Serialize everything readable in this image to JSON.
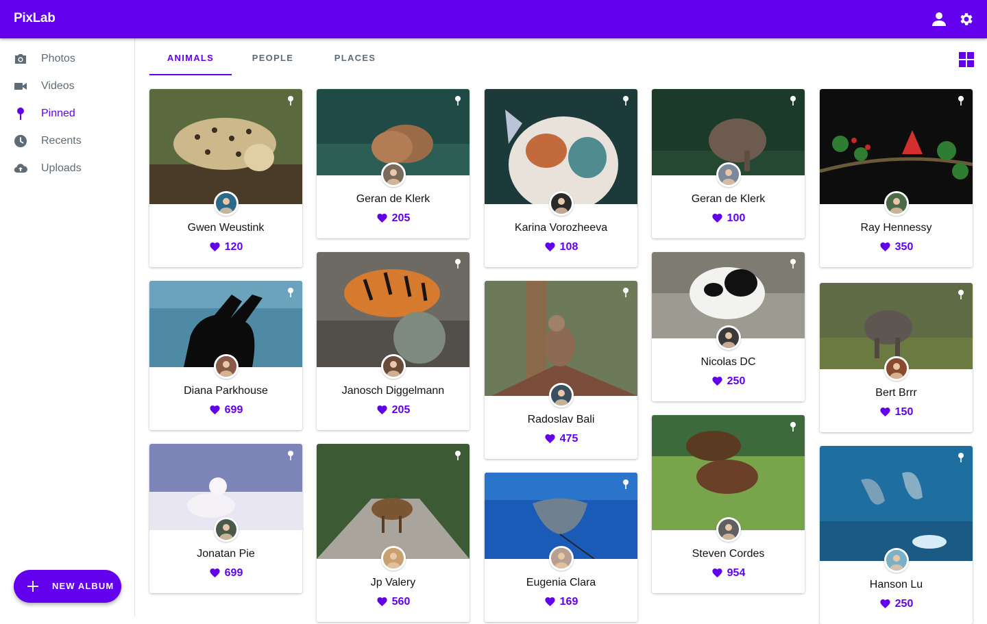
{
  "app": {
    "title": "PixLab"
  },
  "topbar": {
    "account_icon": "account-icon",
    "settings_icon": "settings-icon"
  },
  "sidebar": {
    "items": [
      {
        "label": "Photos",
        "icon": "camera-icon"
      },
      {
        "label": "Videos",
        "icon": "videocam-icon"
      },
      {
        "label": "Pinned",
        "icon": "pin-icon",
        "active": true
      },
      {
        "label": "Recents",
        "icon": "clock-icon"
      },
      {
        "label": "Uploads",
        "icon": "cloud-upload-icon"
      }
    ]
  },
  "fab": {
    "label": "NEW ALBUM"
  },
  "tabs": [
    {
      "label": "ANIMALS",
      "active": true
    },
    {
      "label": "PEOPLE"
    },
    {
      "label": "PLACES"
    }
  ],
  "colors": {
    "accent": "#6200ee",
    "text_muted": "#5f6b75"
  },
  "cards": [
    {
      "name": "Gwen Weustink",
      "likes": "120",
      "subject": "leopard"
    },
    {
      "name": "Diana Parkhouse",
      "likes": "699",
      "subject": "moose silhouette"
    },
    {
      "name": "Jonatan Pie",
      "likes": "699",
      "subject": "arctic fox"
    },
    {
      "name": "Geran de Klerk",
      "likes": "205",
      "subject": "lions"
    },
    {
      "name": "Janosch Diggelmann",
      "likes": "205",
      "subject": "tiger"
    },
    {
      "name": "Jp Valery",
      "likes": "560",
      "subject": "elk on road"
    },
    {
      "name": "Karina Vorozheeva",
      "likes": "108",
      "subject": "cat with butterfly"
    },
    {
      "name": "Radoslav Bali",
      "likes": "475",
      "subject": "monkey"
    },
    {
      "name": "Eugenia Clara",
      "likes": "169",
      "subject": "stingray"
    },
    {
      "name": "Geran de Klerk",
      "likes": "100",
      "subject": "elephant"
    },
    {
      "name": "Nicolas DC",
      "likes": "250",
      "subject": "panda"
    },
    {
      "name": "Steven Cordes",
      "likes": "954",
      "subject": "bison and bear"
    },
    {
      "name": "Ray Hennessy",
      "likes": "350",
      "subject": "cardinal"
    },
    {
      "name": "Bert Brrr",
      "likes": "150",
      "subject": "baby elephant"
    },
    {
      "name": "Hanson Lu",
      "likes": "250",
      "subject": "dolphins"
    }
  ]
}
